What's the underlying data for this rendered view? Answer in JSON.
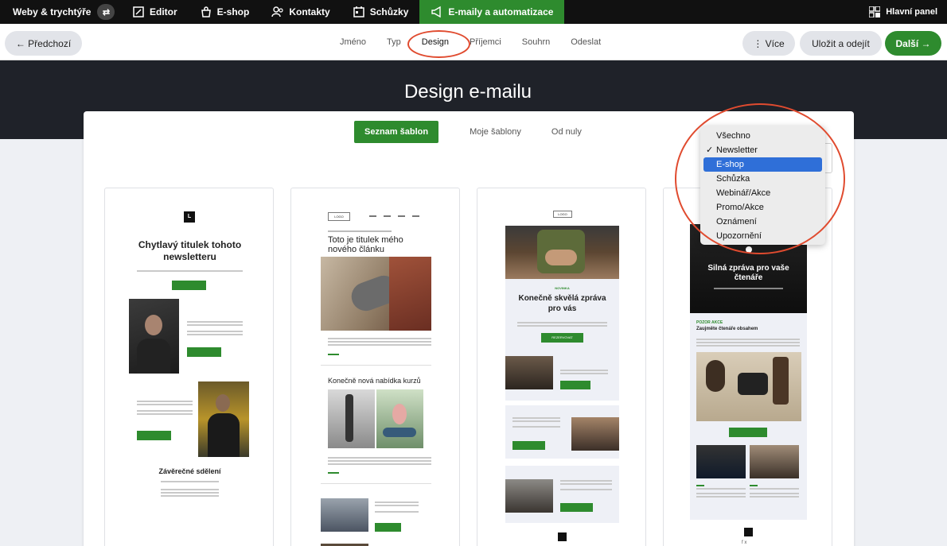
{
  "topnav": {
    "brand": "Weby & trychtýře",
    "items": [
      {
        "label": "Editor",
        "icon": "editor-icon"
      },
      {
        "label": "E-shop",
        "icon": "shop-bag-icon"
      },
      {
        "label": "Kontakty",
        "icon": "contacts-icon"
      },
      {
        "label": "Schůzky",
        "icon": "calendar-icon"
      },
      {
        "label": "E-maily a automatizace",
        "icon": "megaphone-icon"
      }
    ],
    "dashboard": "Hlavní panel",
    "active_color": "#2e8b2e"
  },
  "stepbar": {
    "prev": "← Předchozí",
    "steps": [
      "Jméno",
      "Typ",
      "Design",
      "Příjemci",
      "Souhrn",
      "Odeslat"
    ],
    "active_step": "Design",
    "more": "⋮  Více",
    "save": "Uložit a odejít",
    "next": "Další →"
  },
  "banner": {
    "title": "Design e-mailu"
  },
  "tabs": {
    "primary": "Seznam šablon",
    "mine": "Moje šablony",
    "scratch": "Od nuly"
  },
  "dropdown": {
    "options": [
      "Všechno",
      "Newsletter",
      "E-shop",
      "Schůzka",
      "Webinář/Akce",
      "Promo/Akce",
      "Oznámení",
      "Upozornění"
    ],
    "checked": "Newsletter",
    "highlighted": "E-shop"
  },
  "cards": {
    "c1": {
      "logo": "L",
      "title": "Chytlavý titulek tohoto newsletteru",
      "closing": "Závěrečné sdělení"
    },
    "c2": {
      "logo": "LOGO",
      "title": "Toto je titulek mého nového článku",
      "section": "Konečně nová nabídka kurzů"
    },
    "c3": {
      "logo": "LOGO",
      "tag": "NOVINKA",
      "title": "Konečně skvělá zpráva pro vás",
      "button": "REZERVOVAT"
    },
    "c4": {
      "title": "Silná zpráva pro vaše čtenáře",
      "tag": "POZOR AKCE",
      "subtitle": "Zaujměte čtenáře obsahem"
    }
  }
}
